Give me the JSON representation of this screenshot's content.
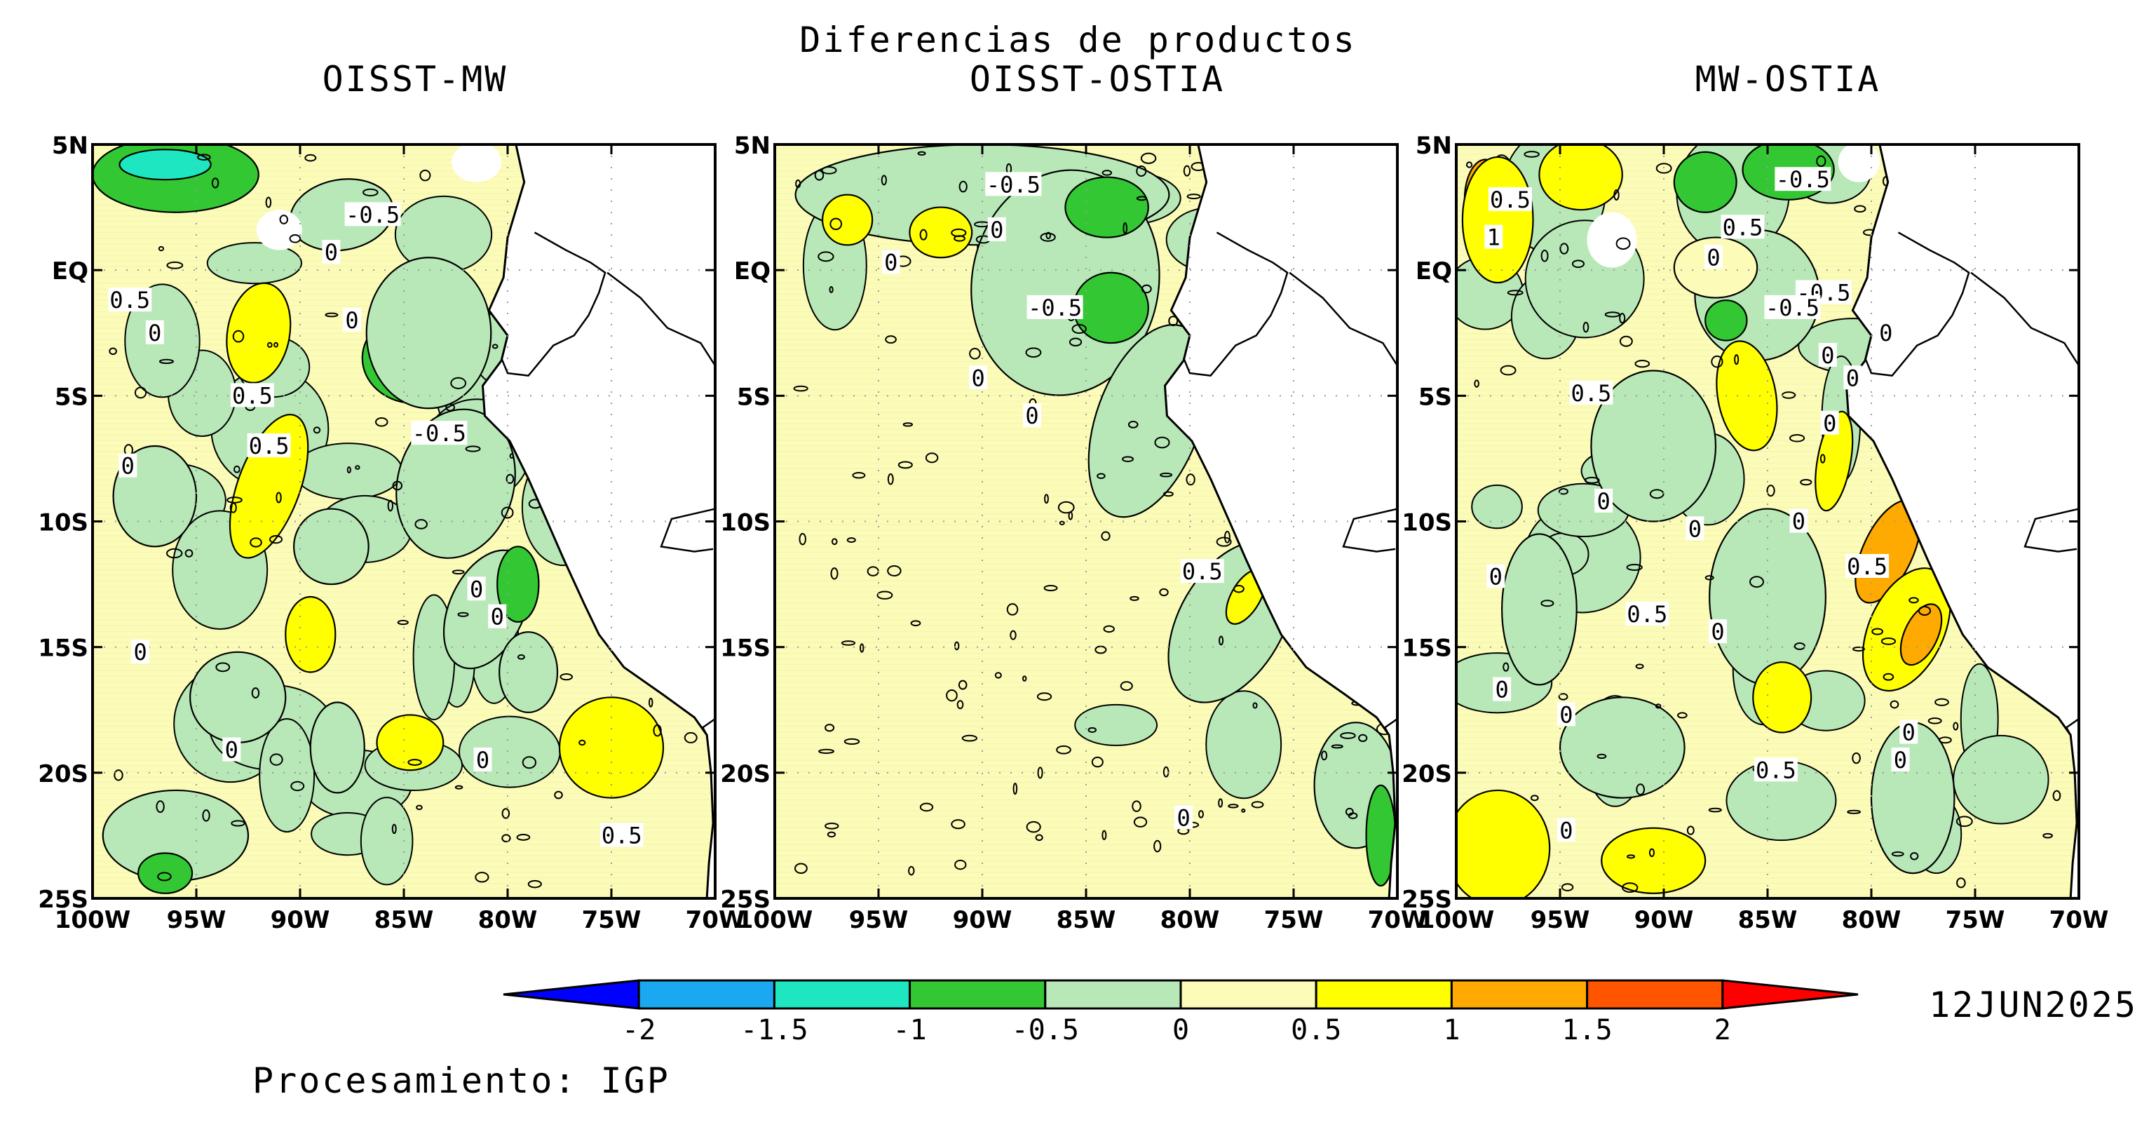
{
  "header": {
    "main_title": "Diferencias de productos"
  },
  "panels": [
    {
      "title": "OISST-MW"
    },
    {
      "title": "OISST-OSTIA"
    },
    {
      "title": "MW-OSTIA"
    }
  ],
  "axes": {
    "lon_ticks": [
      "100W",
      "95W",
      "90W",
      "85W",
      "80W",
      "75W",
      "70W"
    ],
    "lat_ticks": [
      "5N",
      "EQ",
      "5S",
      "10S",
      "15S",
      "20S",
      "25S"
    ],
    "lon_range": [
      -100,
      -70
    ],
    "lat_range": [
      -25,
      5
    ]
  },
  "colorbar": {
    "levels": [
      "-2",
      "-1.5",
      "-1",
      "-0.5",
      "0",
      "0.5",
      "1",
      "1.5",
      "2"
    ],
    "colors": [
      "#0000ff",
      "#1aa8f0",
      "#1de6c0",
      "#33c833",
      "#b8e8b8",
      "#fcfcb8",
      "#ffff00",
      "#ffaa00",
      "#ff5500",
      "#ff0000"
    ]
  },
  "contour_labels": [
    [
      "-0.5",
      "0",
      "0.5",
      "0",
      "0.5",
      "0.5",
      "0",
      "-0.5",
      "0",
      "0",
      "0",
      "0",
      "0",
      "0",
      "0.5"
    ],
    [
      "-0.5",
      "0",
      "0",
      "-0.5",
      "0",
      "0",
      "0.5",
      "0"
    ],
    [
      "0.5",
      "1",
      "-0.5",
      "0.5",
      "0",
      "-0.5",
      "-0.5",
      "0",
      "0",
      "0",
      "0.5",
      "0",
      "0",
      "0",
      "0.5",
      "0",
      "0",
      "0.5",
      "0",
      "0",
      "0",
      "0",
      "0",
      "0.5",
      "0"
    ]
  ],
  "footer": {
    "date": "12JUN2025",
    "credit": "Procesamiento: IGP"
  }
}
